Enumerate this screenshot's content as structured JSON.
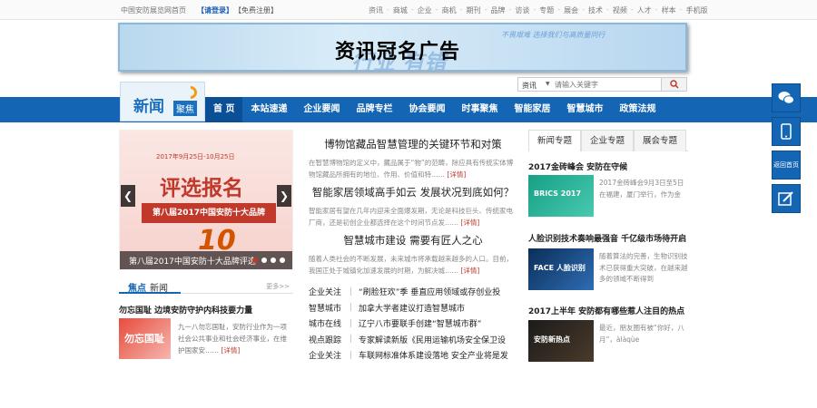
{
  "topbar": {
    "site_name": "中国安防展览网首页",
    "login": "【请登录】",
    "register": "【免费注册】",
    "links": [
      "资讯",
      "商城",
      "企业",
      "商机",
      "期刊",
      "品牌",
      "访谈",
      "专题",
      "展会",
      "技术",
      "视频",
      "人才",
      "样本",
      "手机版"
    ]
  },
  "banner": {
    "title": "资讯冠名广告",
    "ghost_text": "行业 有错",
    "ghost_small": "不畏艰难 选择我们与高质量同行"
  },
  "search": {
    "category": "资讯",
    "placeholder": "请输入关键字"
  },
  "logo": {
    "main": "新闻",
    "tag": "聚焦"
  },
  "nav": {
    "items": [
      "首 页",
      "本站速递",
      "企业要闻",
      "品牌专栏",
      "协会要闻",
      "时事聚焦",
      "智能家居",
      "智慧城市",
      "政策法规"
    ]
  },
  "slider": {
    "date": "2017年9月25日-10月25日",
    "big_text": "评选报名",
    "ribbon": "第八届2017中国安防十大品牌",
    "number": "10",
    "caption": "第八届2017中国安防十大品牌评选"
  },
  "focus": {
    "title_highlight": "焦点",
    "title_rest": "新闻",
    "more": "更多>>",
    "headline": "勿忘国耻 边境安防守护内科技要力量",
    "image_text": "勿忘国耻",
    "summary": "九一八勿忘国耻，安防行业作为一项社会公共事业和社会经济事业，在维护国家安……",
    "detail": "[详情]"
  },
  "mid_articles": [
    {
      "title": "博物馆藏品智慧管理的关键环节和对策",
      "summary": "在智慧博物馆的定义中，藏品属于“物”的范畴，除应具有传统实体博物馆藏品所拥有的地位、作用、价值和特……",
      "detail": "[详情]"
    },
    {
      "title": "智能家居领域高手如云 发展状况到底如何？",
      "summary": "智能家居有望在几年内迎来全面爆发期，无论是科技巨头、传统家电厂商，还是初创企业都选择在这个时间节点发……",
      "detail": "[详情]"
    },
    {
      "title": "智慧城市建设 需要有匠人之心",
      "summary": "随着人类社会的不断发展，未来城市将承载越来越多的人口。目前，我国正处于城镇化加速发展的时期，为解决城……",
      "detail": "[详情]"
    }
  ],
  "mid_list": [
    {
      "cat": "企业关注",
      "title": "“刷脸狂欢”季 垂直应用领域或存创业投"
    },
    {
      "cat": "智慧城市",
      "title": "加拿大学者建议打造智慧城市"
    },
    {
      "cat": "城市在线",
      "title": "辽宁八市要联手创建“智慧城市群”"
    },
    {
      "cat": "视点跟踪",
      "title": "专家解读新版《民用运输机场安全保卫设"
    },
    {
      "cat": "企业关注",
      "title": "车联网标准体系建设落地 安全产业将是发"
    }
  ],
  "right": {
    "tabs": [
      "新闻专题",
      "企业专题",
      "展会专题"
    ],
    "items": [
      {
        "title": "2017金砖峰会 安防在守候",
        "image_text": "BRICS 2017",
        "summary": "2017金砖峰会9月3日至5日在福建，厦门举行，作为金"
      },
      {
        "title": "人脸识别技术奏响最强音 千亿级市场待开启",
        "image_text": "FACE 人脸识别",
        "summary": "随着算法的完善，生物识别技术已获得重大突破，在越来越多的领域不断得到"
      },
      {
        "title": "2017上半年 安防都有哪些惹人注目的热点",
        "image_text": "安防新热点",
        "summary": "最近，朋友圈有被“你好，八月”，àlàqùe"
      }
    ]
  },
  "float_bar": {
    "back_home": "返回首页"
  },
  "colors": {
    "nav_blue": "#1565b5",
    "accent_red": "#c0392b"
  }
}
